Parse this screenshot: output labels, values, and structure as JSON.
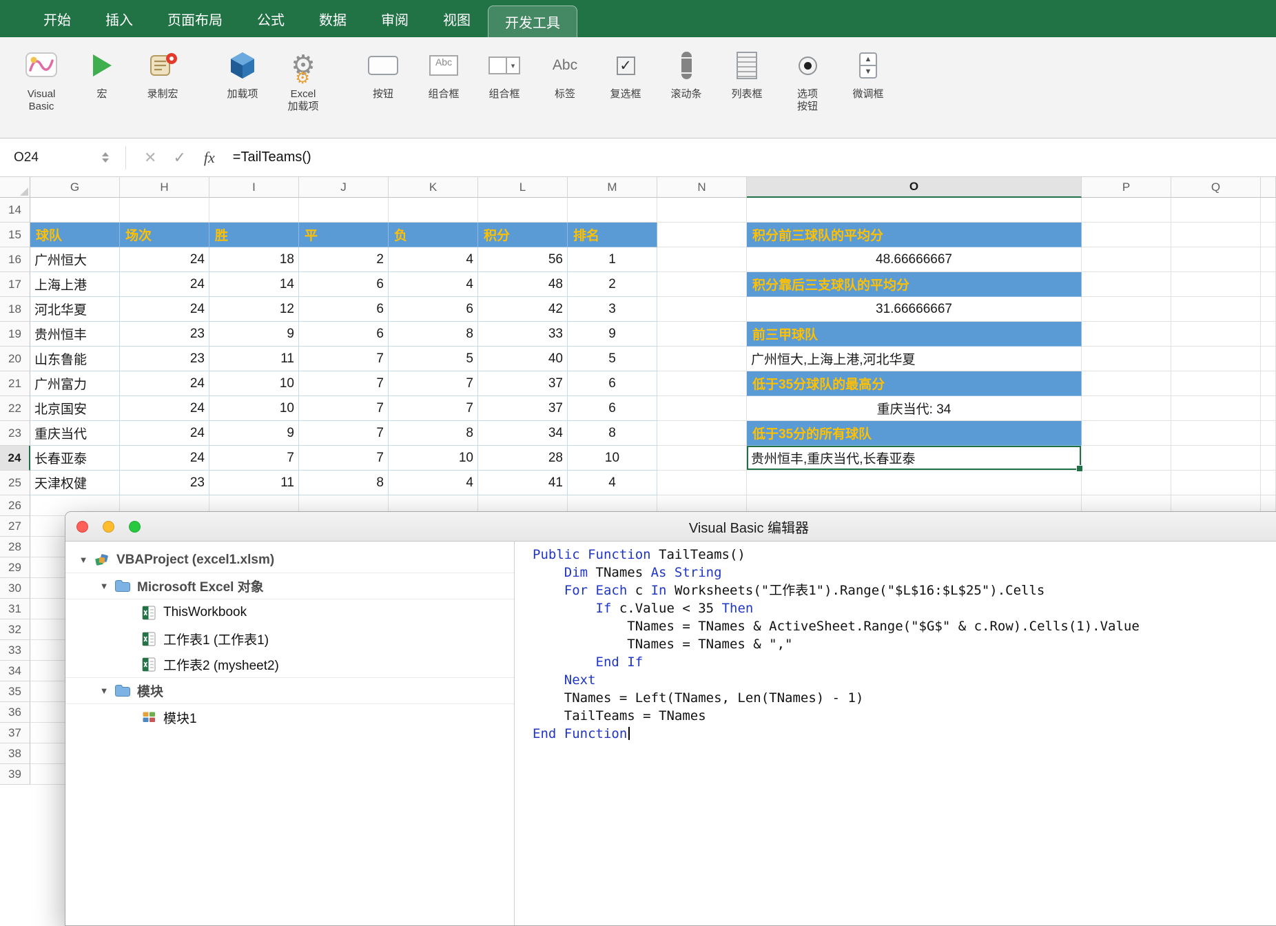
{
  "colors": {
    "ribbon_green": "#217346",
    "selection_green": "#1e7145",
    "table_header_fill": "#5b9bd5",
    "table_header_text": "#ffc000",
    "keyword_blue": "#1f36c7"
  },
  "ribbon": {
    "tabs": [
      "开始",
      "插入",
      "页面布局",
      "公式",
      "数据",
      "审阅",
      "视图",
      "开发工具"
    ],
    "active_tab": "开发工具",
    "buttons": [
      {
        "label": "Visual\nBasic",
        "icon": "visual-basic"
      },
      {
        "label": "宏",
        "icon": "macro-play"
      },
      {
        "label": "录制宏",
        "icon": "record-macro"
      },
      {
        "label": "加载项",
        "icon": "add-ins",
        "group_start": true
      },
      {
        "label": "Excel\n加载项",
        "icon": "excel-add-ins"
      },
      {
        "label": "按钮",
        "icon": "form-button",
        "group_start": true
      },
      {
        "label": "组合框",
        "icon": "combo-field",
        "icon_text": "Abc"
      },
      {
        "label": "组合框",
        "icon": "combo-dropdown"
      },
      {
        "label": "标签",
        "icon": "label-abc",
        "icon_text": "Abc"
      },
      {
        "label": "复选框",
        "icon": "checkbox",
        "icon_text": "✓"
      },
      {
        "label": "滚动条",
        "icon": "scrollbar"
      },
      {
        "label": "列表框",
        "icon": "listbox"
      },
      {
        "label": "选项\n按钮",
        "icon": "option-button"
      },
      {
        "label": "微调框",
        "icon": "spinner"
      }
    ]
  },
  "formula_bar": {
    "name_box": "O24",
    "formula": "=TailTeams()",
    "fx_label": "fx",
    "cancel_glyph": "✕",
    "confirm_glyph": "✓"
  },
  "sheet": {
    "column_headers": [
      "G",
      "H",
      "I",
      "J",
      "K",
      "L",
      "M",
      "N",
      "O",
      "P",
      "Q"
    ],
    "row_start": 14,
    "row_end": 39,
    "selected": {
      "cell": "O24",
      "column": "O",
      "row": 24
    },
    "table": {
      "header_row": 15,
      "headers": [
        "球队",
        "场次",
        "胜",
        "平",
        "负",
        "积分",
        "排名"
      ],
      "rows": [
        {
          "row": 16,
          "cells": [
            "广州恒大",
            "24",
            "18",
            "2",
            "4",
            "56",
            "1"
          ]
        },
        {
          "row": 17,
          "cells": [
            "上海上港",
            "24",
            "14",
            "6",
            "4",
            "48",
            "2"
          ]
        },
        {
          "row": 18,
          "cells": [
            "河北华夏",
            "24",
            "12",
            "6",
            "6",
            "42",
            "3"
          ]
        },
        {
          "row": 19,
          "cells": [
            "贵州恒丰",
            "23",
            "9",
            "6",
            "8",
            "33",
            "9"
          ]
        },
        {
          "row": 20,
          "cells": [
            "山东鲁能",
            "23",
            "11",
            "7",
            "5",
            "40",
            "5"
          ]
        },
        {
          "row": 21,
          "cells": [
            "广州富力",
            "24",
            "10",
            "7",
            "7",
            "37",
            "6"
          ]
        },
        {
          "row": 22,
          "cells": [
            "北京国安",
            "24",
            "10",
            "7",
            "7",
            "37",
            "6"
          ]
        },
        {
          "row": 23,
          "cells": [
            "重庆当代",
            "24",
            "9",
            "7",
            "8",
            "34",
            "8"
          ]
        },
        {
          "row": 24,
          "cells": [
            "长春亚泰",
            "24",
            "7",
            "7",
            "10",
            "28",
            "10"
          ]
        },
        {
          "row": 25,
          "cells": [
            "天津权健",
            "23",
            "11",
            "8",
            "4",
            "41",
            "4"
          ]
        }
      ]
    },
    "analysis_column": {
      "column": "O",
      "cells": [
        {
          "row": 15,
          "text": "积分前三球队的平均分",
          "type": "header"
        },
        {
          "row": 16,
          "text": "48.66666667",
          "type": "value-center"
        },
        {
          "row": 17,
          "text": "积分靠后三支球队的平均分",
          "type": "header"
        },
        {
          "row": 18,
          "text": "31.66666667",
          "type": "value-center"
        },
        {
          "row": 19,
          "text": "前三甲球队",
          "type": "header"
        },
        {
          "row": 20,
          "text": "广州恒大,上海上港,河北华夏",
          "type": "value-left"
        },
        {
          "row": 21,
          "text": "低于35分球队的最高分",
          "type": "header"
        },
        {
          "row": 22,
          "text": "重庆当代: 34",
          "type": "value-center"
        },
        {
          "row": 23,
          "text": "低于35分的所有球队",
          "type": "header"
        },
        {
          "row": 24,
          "text": "贵州恒丰,重庆当代,长春亚泰",
          "type": "value-left"
        }
      ]
    }
  },
  "vba": {
    "title": "Visual Basic 编辑器",
    "project_tree": [
      {
        "label": "VBAProject (excel1.xlsm)",
        "level": 0,
        "icon": "vba-project",
        "bold": true,
        "disclosure": "▼",
        "separator": true
      },
      {
        "label": "Microsoft Excel 对象",
        "level": 1,
        "icon": "folder",
        "bold": true,
        "disclosure": "▼",
        "separator": true
      },
      {
        "label": "ThisWorkbook",
        "level": 2,
        "icon": "excel-sheet",
        "separator": false
      },
      {
        "label": "工作表1 (工作表1)",
        "level": 2,
        "icon": "excel-sheet",
        "separator": false
      },
      {
        "label": "工作表2 (mysheet2)",
        "level": 2,
        "icon": "excel-sheet",
        "separator": true
      },
      {
        "label": "模块",
        "level": 1,
        "icon": "folder",
        "bold": true,
        "disclosure": "▼",
        "separator": true
      },
      {
        "label": "模块1",
        "level": 2,
        "icon": "module",
        "separator": false
      }
    ],
    "code": [
      [
        [
          "k",
          "Public Function"
        ],
        [
          "t",
          " TailTeams()"
        ]
      ],
      [
        [
          "t",
          "    "
        ],
        [
          "k",
          "Dim"
        ],
        [
          "t",
          " TNames "
        ],
        [
          "k",
          "As String"
        ]
      ],
      [
        [
          "t",
          "    "
        ],
        [
          "k",
          "For Each"
        ],
        [
          "t",
          " c "
        ],
        [
          "k",
          "In"
        ],
        [
          "t",
          " Worksheets(\"工作表1\").Range(\"$L$16:$L$25\").Cells"
        ]
      ],
      [
        [
          "t",
          "        "
        ],
        [
          "k",
          "If"
        ],
        [
          "t",
          " c.Value < 35 "
        ],
        [
          "k",
          "Then"
        ]
      ],
      [
        [
          "t",
          "            TNames = TNames & ActiveSheet.Range(\"$G$\" & c.Row).Cells(1).Value"
        ]
      ],
      [
        [
          "t",
          "            TNames = TNames & \",\""
        ]
      ],
      [
        [
          "t",
          "        "
        ],
        [
          "k",
          "End If"
        ]
      ],
      [
        [
          "t",
          "    "
        ],
        [
          "k",
          "Next"
        ]
      ],
      [
        [
          "t",
          "    TNames = Left(TNames, Len(TNames) - 1)"
        ]
      ],
      [
        [
          "t",
          "    TailTeams = TNames"
        ]
      ],
      [
        [
          "k",
          "End Function"
        ],
        [
          "cursor",
          ""
        ]
      ]
    ]
  }
}
